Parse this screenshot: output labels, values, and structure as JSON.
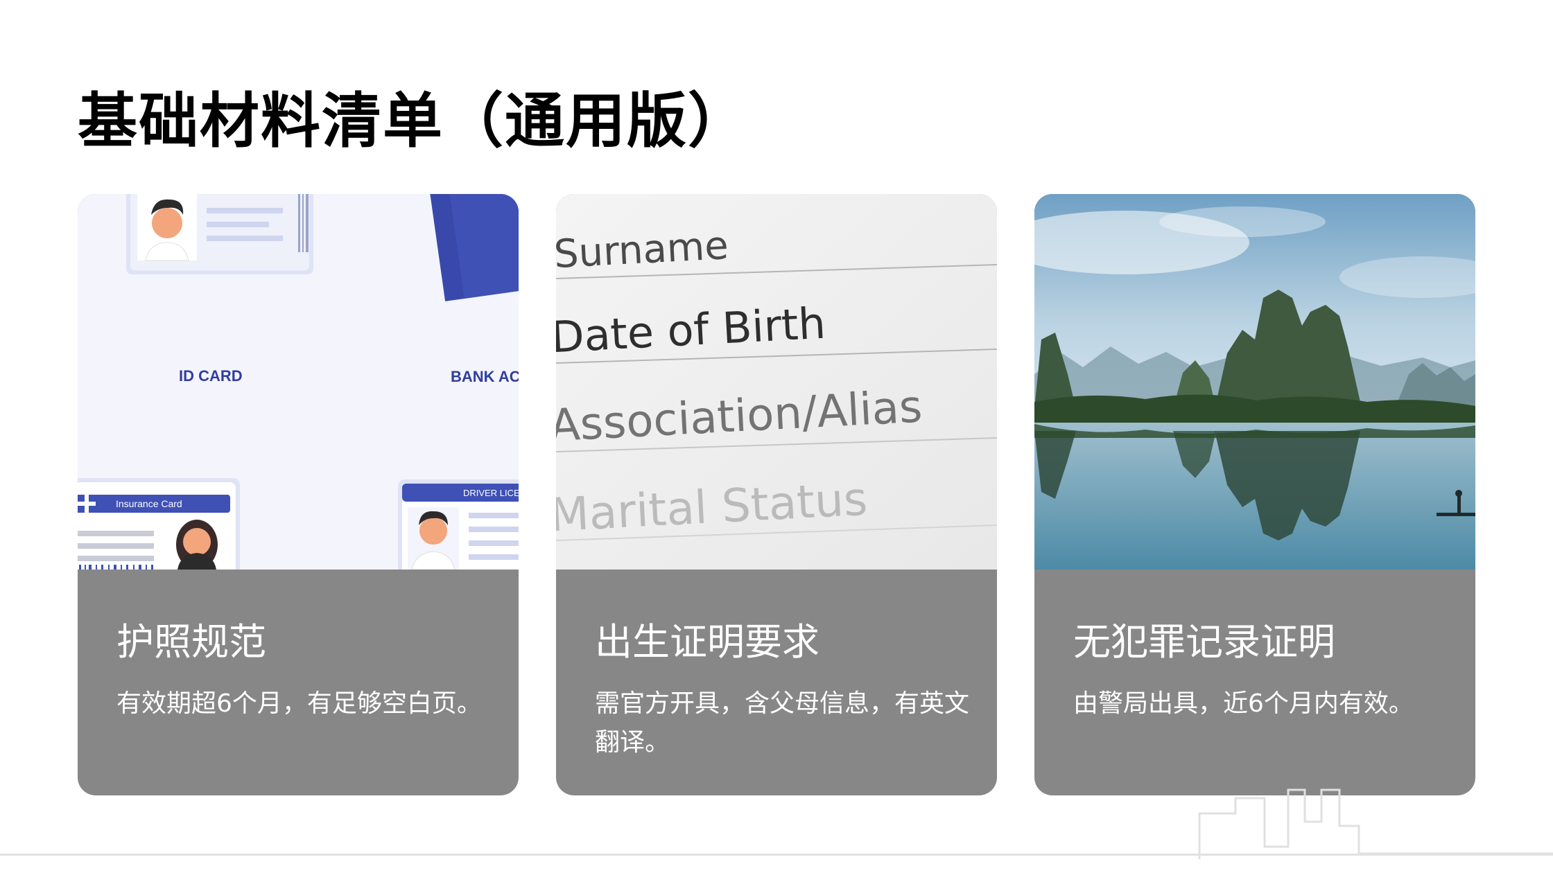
{
  "page": {
    "title": "基础材料清单（通用版）"
  },
  "cards": [
    {
      "title": "护照规范",
      "description": "有效期超6个月，有足够空白页。",
      "image": {
        "subject": "id-documents-illustration",
        "labels": [
          "ID CARD",
          "BANK AC",
          "Insurance Card",
          "DRIVER LICE"
        ]
      }
    },
    {
      "title": "出生证明要求",
      "description": "需官方开具，含父母信息，有英文翻译。",
      "image": {
        "subject": "form-photo",
        "labels": [
          "Surname",
          "Date of Birth",
          "Association/Alias",
          "Marital Status"
        ]
      }
    },
    {
      "title": "无犯罪记录证明",
      "description": "由警局出具，近6个月内有效。",
      "image": {
        "subject": "karst-river-landscape-photo"
      }
    }
  ],
  "colors": {
    "title": "#000000",
    "card_body": "#878787",
    "card_text": "#ffffff",
    "illustration_blue": "#3f51b5"
  }
}
